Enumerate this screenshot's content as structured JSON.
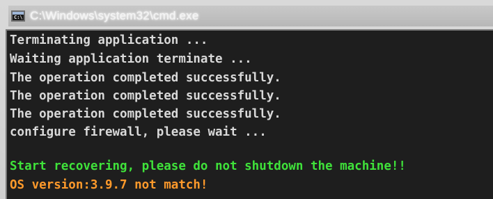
{
  "window": {
    "title": "C:\\Windows\\system32\\cmd.exe",
    "icon": "console-icon",
    "icon_label": "C:\\"
  },
  "console": {
    "background": "#1e1e1e",
    "colors": {
      "default": "#d9d9d9",
      "success": "#3fe23a",
      "error": "#ff9a2b"
    },
    "lines": [
      "Terminating application ...",
      "Waiting application terminate ...",
      "The operation completed successfully.",
      "The operation completed successfully.",
      "The operation completed successfully.",
      "configure firewall, please wait ...",
      "Start recovering, please do not shutdown the machine!!",
      "OS version:3.9.7 not match!"
    ]
  }
}
